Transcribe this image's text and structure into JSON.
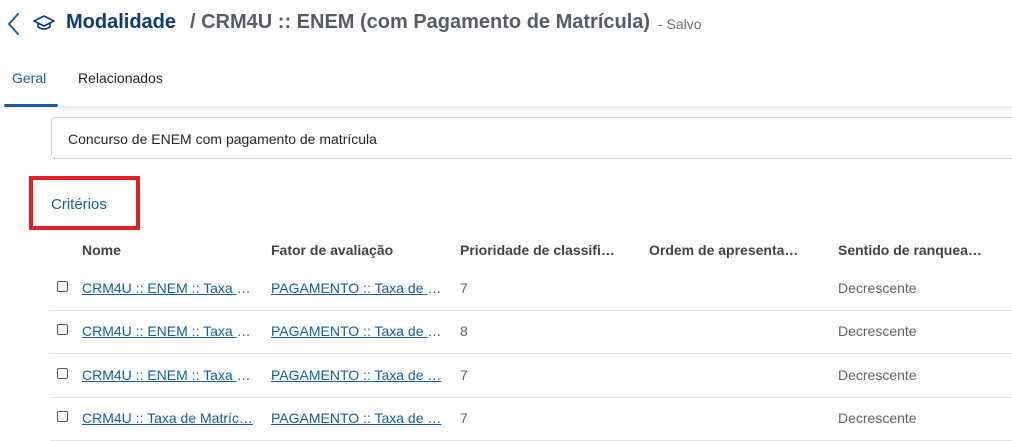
{
  "header": {
    "back_icon": "chevron-left-icon",
    "entity_icon": "graduation-cap-icon",
    "title": "Modalidade",
    "record_name": "/ CRM4U :: ENEM (com Pagamento de Matrícula)",
    "status": "- Salvo"
  },
  "tabs": [
    {
      "label": "Geral",
      "selected": true
    },
    {
      "label": "Relacionados",
      "selected": false
    }
  ],
  "description_field": {
    "value": "Concurso de ENEM com pagamento de matrícula"
  },
  "criteria": {
    "section_title": "Critérios",
    "highlight_color": "#e31e24",
    "columns": [
      "Nome",
      "Fator de avaliação",
      "Prioridade de classifi…",
      "Ordem de apresenta…",
      "Sentido de ranquea…"
    ],
    "rows": [
      {
        "nome": "CRM4U :: ENEM :: Taxa d…",
        "fator": "PAGAMENTO :: Taxa de I…",
        "prioridade": "7",
        "ordem": "",
        "sentido": "Decrescente"
      },
      {
        "nome": "CRM4U :: ENEM :: Taxa d…",
        "fator": "PAGAMENTO :: Taxa de I…",
        "prioridade": "8",
        "ordem": "",
        "sentido": "Decrescente"
      },
      {
        "nome": "CRM4U :: ENEM :: Taxa d…",
        "fator": "PAGAMENTO :: Taxa de …",
        "prioridade": "7",
        "ordem": "",
        "sentido": "Decrescente"
      },
      {
        "nome": "CRM4U :: Taxa de Matríc…",
        "fator": "PAGAMENTO :: Taxa de …",
        "prioridade": "7",
        "ordem": "",
        "sentido": "Decrescente"
      }
    ]
  },
  "colors": {
    "accent": "#115ea3",
    "title": "#0b3a7e"
  }
}
